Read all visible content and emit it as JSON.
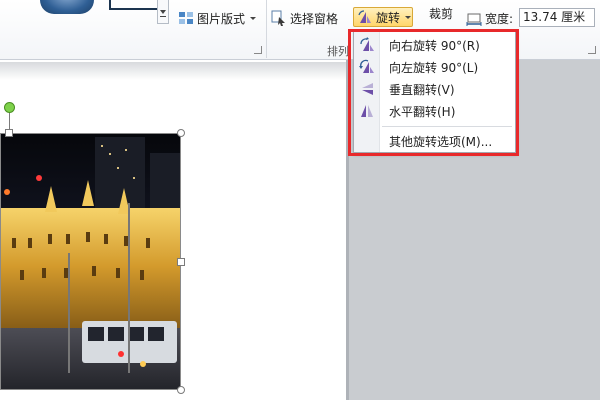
{
  "ribbon": {
    "picture_layout_label": "图片版式",
    "selection_pane_label": "选择窗格",
    "rotate_label": "旋转",
    "crop_label": "裁剪",
    "width_label": "宽度:",
    "width_value": "13.74 厘米",
    "arrange_group_label": "排列"
  },
  "rotate_menu": {
    "items": [
      {
        "label": "向右旋转 90°(R)",
        "icon": "rotate-right-icon"
      },
      {
        "label": "向左旋转 90°(L)",
        "icon": "rotate-left-icon"
      },
      {
        "label": "垂直翻转(V)",
        "icon": "flip-vertical-icon"
      },
      {
        "label": "水平翻转(H)",
        "icon": "flip-horizontal-icon"
      }
    ],
    "more_label": "其他旋转选项(M)..."
  },
  "colors": {
    "highlight": "#e8292b",
    "rotate_active": "#ffd66b",
    "icon_purple": "#6d4fa8",
    "icon_blue": "#2f5f95"
  }
}
